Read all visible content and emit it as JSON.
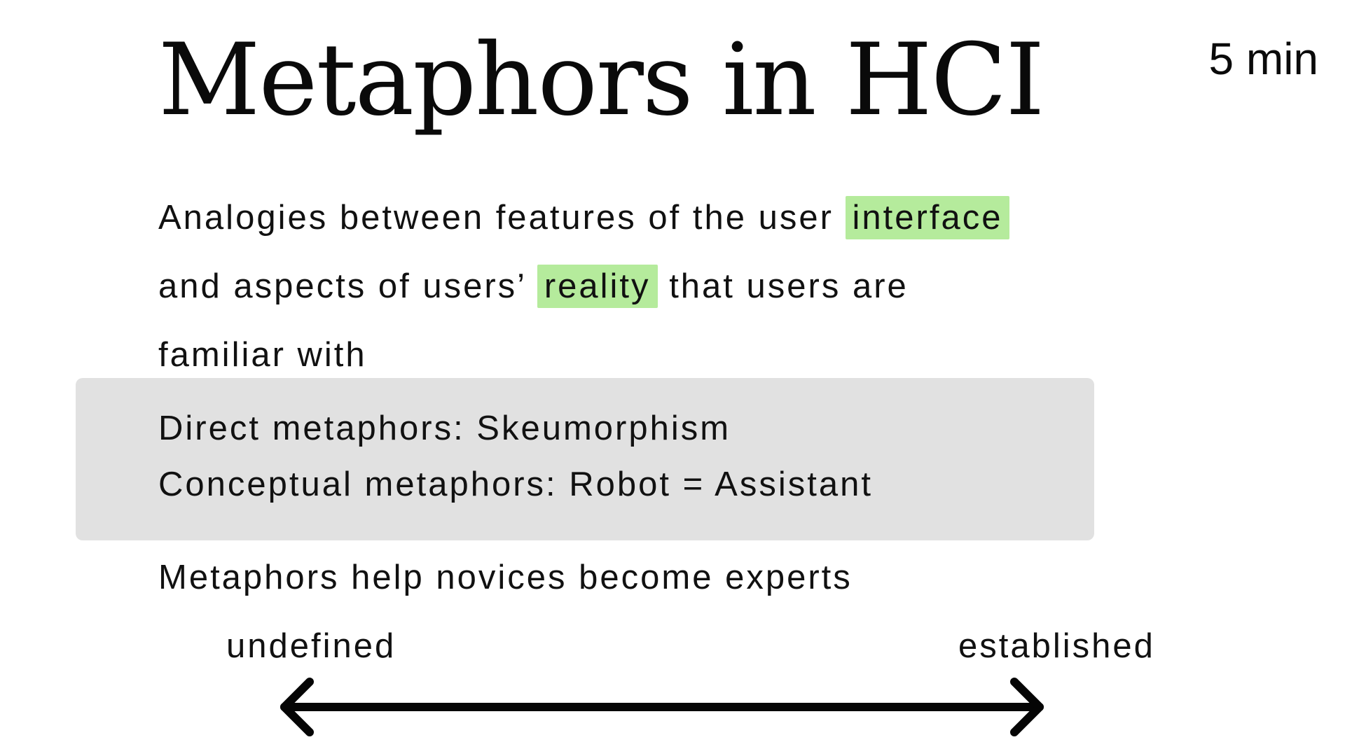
{
  "slide": {
    "title": "Metaphors in HCI",
    "timer": "5 min"
  },
  "definition": {
    "line1_prefix": "Analogies between features of the user",
    "highlight1": "interface",
    "line2_prefix": "and aspects of users’",
    "highlight2": "reality",
    "line2_suffix": "that users are",
    "line3": "familiar with",
    "highlight_color": "#b5eb9c"
  },
  "callout": {
    "line1": "Direct metaphors: Skeumorphism",
    "line2": "Conceptual metaphors: Robot = Assistant",
    "background": "#e1e1e1"
  },
  "summary": "Metaphors help novices become experts",
  "scale": {
    "left_label": "undefined",
    "right_label": "established",
    "icon": "double-headed-arrow-icon"
  }
}
